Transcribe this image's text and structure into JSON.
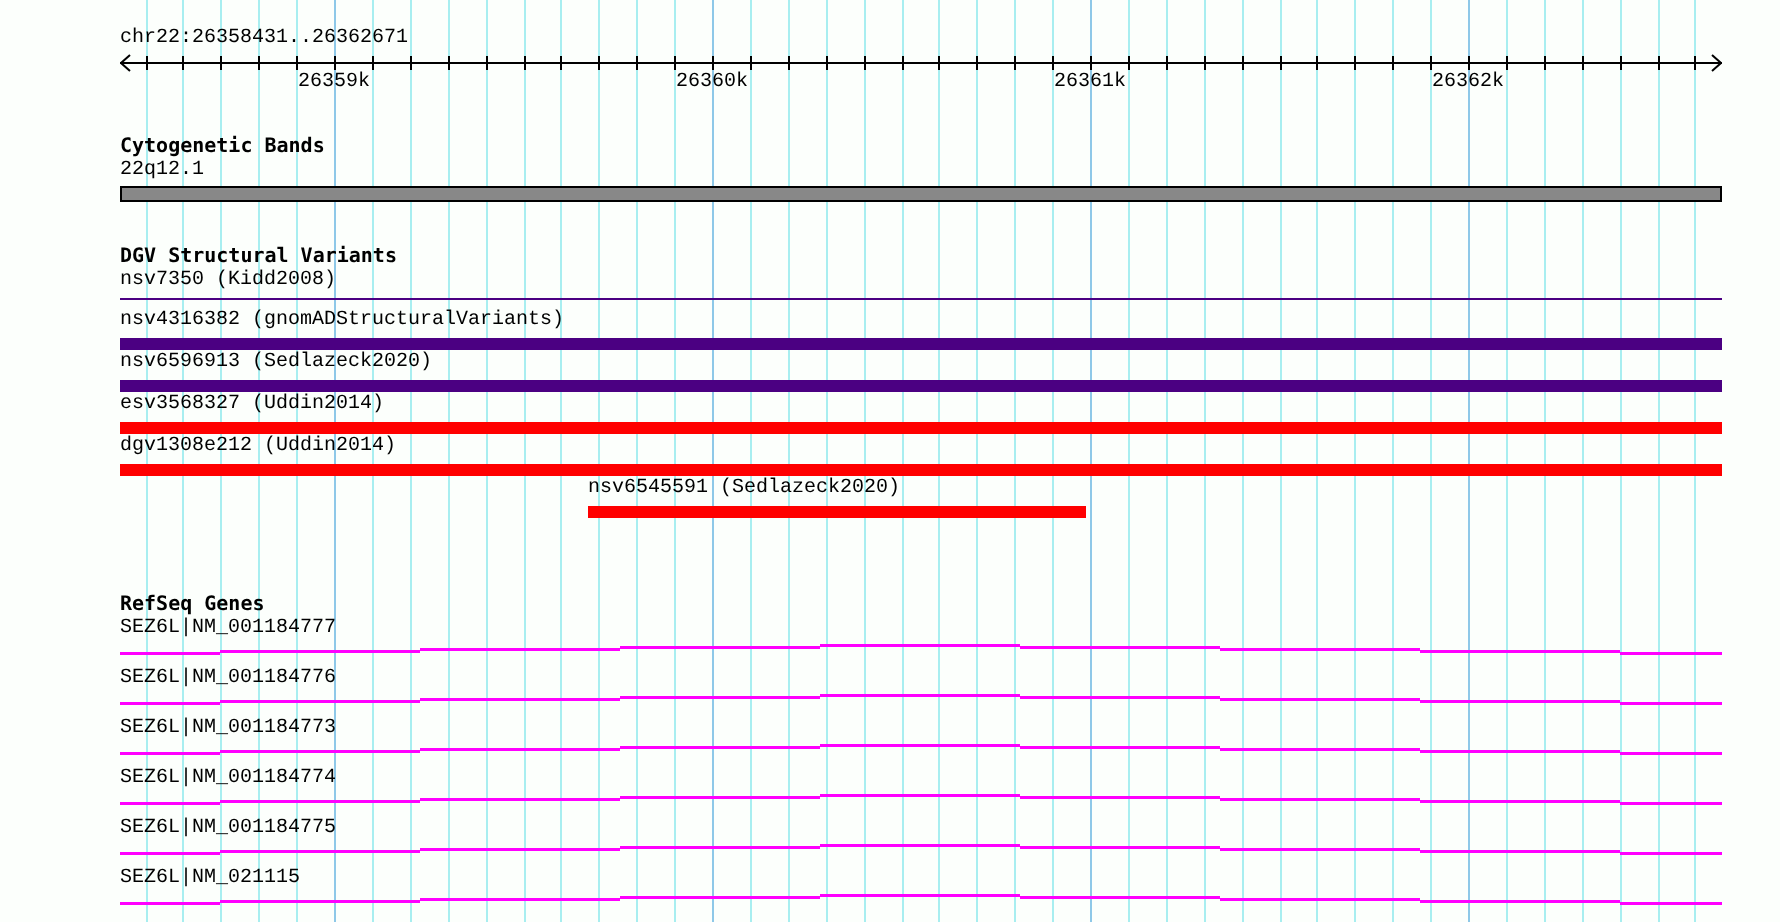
{
  "ruler": {
    "range": "chr22:26358431..26362671",
    "ticks": [
      "26359k",
      "26360k",
      "26361k",
      "26362k"
    ]
  },
  "tracks": [
    {
      "title": "Cytogenetic Bands",
      "features": [
        {
          "label": "22q12.1",
          "kind": "band"
        }
      ]
    },
    {
      "title": "DGV Structural Variants",
      "features": [
        {
          "label": "nsv7350 (Kidd2008)",
          "kind": "line",
          "color": "#4b0082"
        },
        {
          "label": "nsv4316382 (gnomADStructuralVariants)",
          "kind": "bar",
          "color": "#4b0082"
        },
        {
          "label": "nsv6596913 (Sedlazeck2020)",
          "kind": "bar",
          "color": "#4b0082"
        },
        {
          "label": "esv3568327 (Uddin2014)",
          "kind": "bar",
          "color": "#ff0000"
        },
        {
          "label": "dgv1308e212 (Uddin2014)",
          "kind": "bar",
          "color": "#ff0000"
        },
        {
          "label": "nsv6545591 (Sedlazeck2020)",
          "kind": "short-bar",
          "color": "#ff0000"
        }
      ]
    },
    {
      "title": "RefSeq Genes",
      "features": [
        {
          "label": "SEZ6L|NM_001184777",
          "kind": "gene"
        },
        {
          "label": "SEZ6L|NM_001184776",
          "kind": "gene"
        },
        {
          "label": "SEZ6L|NM_001184773",
          "kind": "gene"
        },
        {
          "label": "SEZ6L|NM_001184774",
          "kind": "gene"
        },
        {
          "label": "SEZ6L|NM_001184775",
          "kind": "gene"
        },
        {
          "label": "SEZ6L|NM_021115",
          "kind": "gene"
        }
      ]
    }
  ]
}
